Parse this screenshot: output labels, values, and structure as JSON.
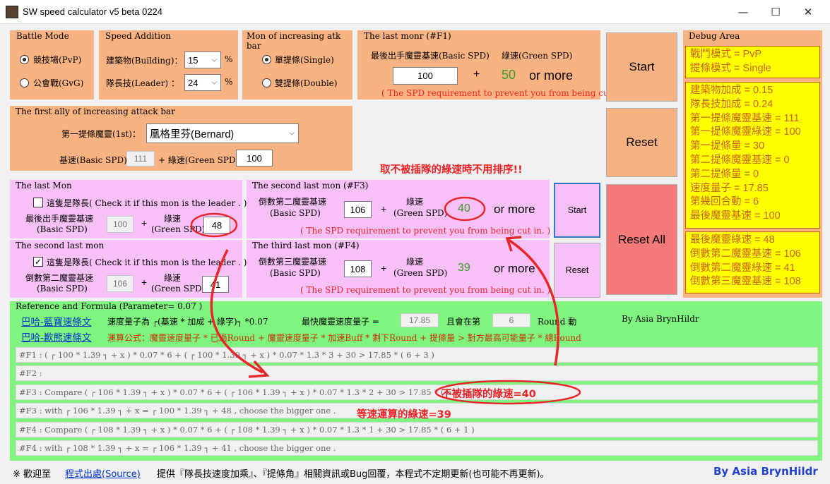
{
  "window": {
    "title": "SW speed calculator v5 beta 0224",
    "min_glyph": "—",
    "max_glyph": "☐",
    "close_glyph": "✕"
  },
  "battle_mode": {
    "title": "Battle Mode",
    "pvp": "競技場(PvP)",
    "gvg": "公會戰(GvG)",
    "selected": "pvp"
  },
  "speed_addition": {
    "title": "Speed Addition",
    "building_label": "建築物(Building)：",
    "building_value": "15",
    "leader_label": "隊長技(Leader) ：",
    "leader_value": "24",
    "unit": "%"
  },
  "atk_bar_mon": {
    "title": "Mon of increasing atk bar",
    "single": "單提條(Single)",
    "double": "雙提條(Double)",
    "selected": "single"
  },
  "last_monr": {
    "title": "The last monr (#F1)",
    "basic_label": "最後出手魔靈基速(Basic SPD)",
    "green_label": "綠速(Green SPD)",
    "basic_value": "100",
    "plus": "+",
    "result_value": "50",
    "or_more": "or more",
    "note": "( The SPD requirement to prevent you from being cut in. )"
  },
  "first_ally": {
    "title": "The first ally of increasing attack bar",
    "mon_label": "第一提條魔靈(1st)：",
    "mon_value": "凰格里芬(Bernard)",
    "basic_label": "基速(Basic SPD)",
    "basic_value": "111",
    "green_label": "+ 綠速(Green SPD)",
    "green_value": "100"
  },
  "notice_no_sort": "取不被插隊的綠速時不用排序!!",
  "last_mon": {
    "title": "The last Mon",
    "leader_check": "這隻是隊長( Check it if this mon is the leader . )",
    "checked": false,
    "basic_label": "最後出手魔靈基速",
    "basic_sub": "(Basic SPD)",
    "basic_value": "100",
    "plus": "+",
    "green_label": "綠速",
    "green_sub": "(Green SPD)",
    "green_value": "48"
  },
  "second_last_mon": {
    "title": "The second last mon",
    "leader_check": "這隻是隊長( Check it if this mon is the leader . )",
    "checked": true,
    "check_glyph": "✓",
    "basic_label": "倒數第二魔靈基速",
    "basic_sub": "(Basic SPD)",
    "basic_value": "106",
    "plus": "+",
    "green_label": "綠速",
    "green_sub": "(Green SPD)",
    "green_value": "41"
  },
  "f3": {
    "title": "The second last mon (#F3)",
    "basic_label": "倒數第二魔靈基速",
    "basic_sub": "(Basic SPD)",
    "basic_value": "106",
    "plus": "+",
    "green_label": "綠速",
    "green_sub": "(Green SPD)",
    "result_value": "40",
    "or_more": "or more",
    "note": "( The SPD requirement to prevent you from being cut in. )"
  },
  "f4": {
    "title": "The third last mon (#F4)",
    "basic_label": "倒數第三魔靈基速",
    "basic_sub": "(Basic SPD)",
    "basic_value": "108",
    "plus": "+",
    "green_label": "綠速",
    "green_sub": "(Green SPD)",
    "result_value": "39",
    "or_more": "or more",
    "note": "( The SPD requirement to prevent you from being cut in. )"
  },
  "buttons": {
    "start_top": "Start",
    "reset_top": "Reset",
    "reset_all": "Reset All",
    "start_small": "Start",
    "reset_small": "Reset"
  },
  "debug": {
    "title": "Debug Area",
    "box1": [
      "戰鬥模式 = PvP",
      "提條模式 = Single"
    ],
    "box2": [
      "建築物加成 = 0.15",
      "隊長技加成 = 0.24",
      "第一提條魔靈基速 = 111",
      "第一提條魔靈綠速 = 100",
      "第一提條量 = 30",
      "第二提條魔靈基速 = 0",
      "第二提條量 = 0",
      "速度量子 = 17.85",
      "第幾回合動 = 6",
      "最後魔靈基速 = 100"
    ],
    "box3": [
      "最後魔靈綠速 = 48",
      "倒數第二魔靈基速 = 106",
      "倒數第二魔靈綠速 = 41",
      "倒數第三魔靈基速 = 108"
    ]
  },
  "reference": {
    "title": "Reference and Formula (Parameter= 0.07 )",
    "link1": "巴哈-藍寶速條文",
    "link2": "巴哈-歉熊速條文",
    "quantum_text": "速度量子為 ┌(基速 * 加成 + 綠字)┐ *0.07",
    "fastest_label": "最快魔靈速度量子 =",
    "fastest_value": "17.85",
    "round_label": "且會在第",
    "round_value": "6",
    "round_suffix": "Round 動",
    "author_small": "By Asia BrynHildr",
    "formula_text": "運算公式：魔靈速度量子 * 已過Round + 魔靈速度量子 * 加速Buff * 剩下Round + 提條量 > 對方最高可能量子 * 總Round",
    "rows": [
      "#F1 : ( ┌ 100 * 1.39 ┐ + x ) * 0.07 * 6 + ( ┌ 100 * 1.39 ┐ + x ) * 0.07 * 1.3 * 3 + 30 > 17.85 * ( 6 + 3 )",
      "#F2 :",
      "#F3 : Compare  ( ┌ 106 * 1.39 ┐ + x ) * 0.07 * 6 + ( ┌ 106 * 1.39 ┐ + x ) * 0.07 * 1.3 * 2 + 30 > 17.85 * ( 6 + 2 )",
      "#F3 :        with    ┌ 106 * 1.39 ┐ + x  =  ┌ 100 * 1.39 ┐ + 48  , choose the bigger one .",
      "#F4 : Compare  ( ┌ 108 * 1.39 ┐ + x ) * 0.07 * 6 + ( ┌ 108 * 1.39 ┐ + x ) * 0.07 * 1.3 * 1 + 30 > 17.85 * ( 6 + 1 )",
      "#F4 :        with    ┌ 108 * 1.39 ┐ + x  =  ┌ 106 * 1.39 ┐ + 41  , choose the bigger one ."
    ]
  },
  "annotations": {
    "not_cut_in": "不被插隊的綠速=40",
    "equal_speed": "等速運算的綠速=39"
  },
  "footer": {
    "prefix": "※ 歡迎至",
    "link": "程式出處(Source)",
    "text": "提供『隊長技速度加乘』、『提條角』相關資訊或Bug回覆，本程式不定期更新(也可能不再更新)。",
    "author": "By Asia BrynHildr"
  },
  "colors": {
    "orange_panel": "#f9b382",
    "pink_panel": "#f7c0f7",
    "green_panel": "#7ff57f",
    "debug_yellow": "#ffff00",
    "reset_all_red": "#f47a7a",
    "annotation_red": "#e8262a",
    "result_green": "#3c9a28"
  }
}
